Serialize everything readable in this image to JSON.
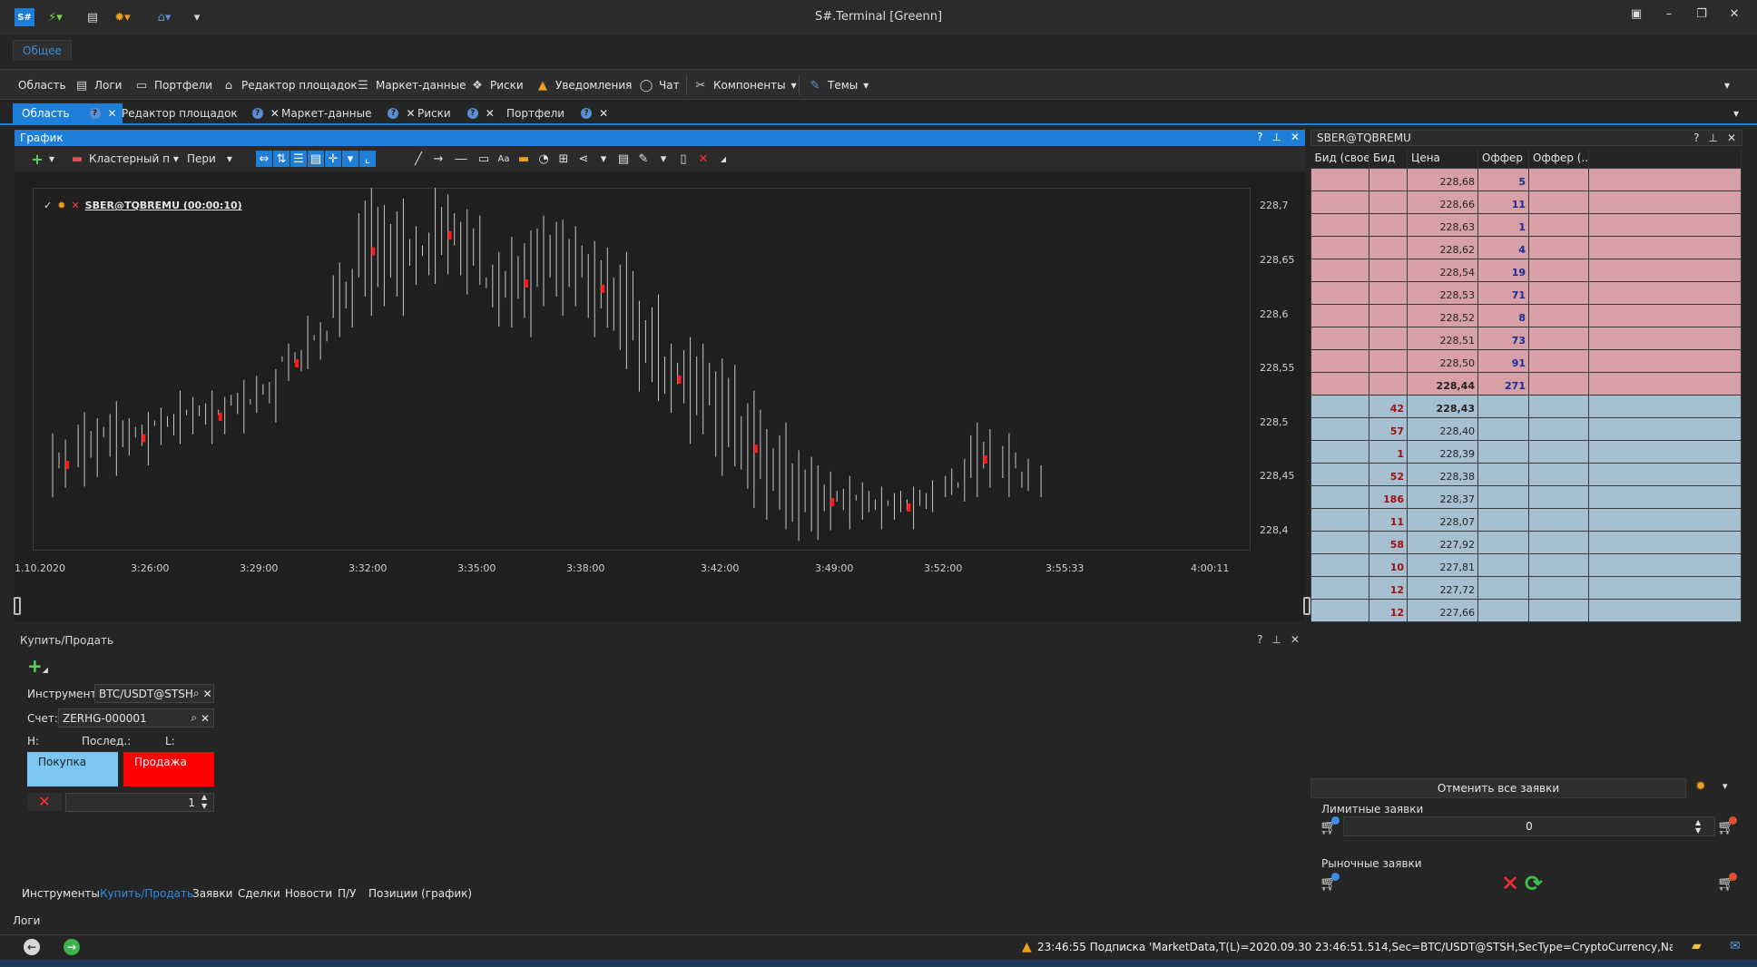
{
  "window": {
    "title": "S#.Terminal [Greenn]",
    "app_badge": "S#"
  },
  "ribbon": {
    "active_tab": "Общее",
    "items": [
      "Область",
      "Логи",
      "Портфели",
      "Редактор площадок",
      "Маркет-данные",
      "Риски",
      "Уведомления",
      "Чат",
      "Компоненты",
      "Темы"
    ]
  },
  "doc_tabs": [
    "Область",
    "Редактор площадок",
    "Маркет-данные",
    "Риски",
    "Портфели"
  ],
  "chart_panel": {
    "title": "График",
    "candle_type": "Кластерный п",
    "period": "Пери",
    "instrument_label": "SBER@TQBREMU (00:00:10)"
  },
  "chart_data": {
    "type": "candlestick",
    "series": [
      {
        "name": "SBER@TQBREMU (00:00:10)"
      }
    ],
    "y_ticks": [
      "228,7",
      "228,65",
      "228,6",
      "228,55",
      "228,5",
      "228,45",
      "228,4"
    ],
    "ylim": [
      228.38,
      228.72
    ],
    "x_ticks": [
      "1.10.2020",
      "3:26:00",
      "3:29:00",
      "3:32:00",
      "3:35:00",
      "3:38:00",
      "3:42:00",
      "3:49:00",
      "3:52:00",
      "3:55:33",
      "4:00:11"
    ],
    "highs": [
      228.49,
      228.51,
      228.52,
      228.51,
      228.52,
      228.53,
      228.53,
      228.54,
      228.55,
      228.58,
      228.6,
      228.65,
      228.72,
      228.71,
      228.69,
      228.72,
      228.7,
      228.66,
      228.68,
      228.7,
      228.69,
      228.67,
      228.66,
      228.62,
      228.58,
      228.58,
      228.56,
      228.53,
      228.5,
      228.48,
      228.46,
      228.45,
      228.44,
      228.44,
      228.44,
      228.45,
      228.5,
      228.49,
      228.46
    ],
    "lows": [
      228.43,
      228.44,
      228.45,
      228.46,
      228.47,
      228.48,
      228.48,
      228.49,
      228.5,
      228.53,
      228.55,
      228.58,
      228.6,
      228.6,
      228.62,
      228.63,
      228.62,
      228.59,
      228.58,
      228.6,
      228.6,
      228.58,
      228.55,
      228.52,
      228.5,
      228.48,
      228.45,
      228.42,
      228.4,
      228.38,
      228.39,
      228.4,
      228.4,
      228.4,
      228.41,
      228.43,
      228.43,
      228.43,
      228.43
    ]
  },
  "buy_sell": {
    "title": "Купить/Продать",
    "instrument_label": "Инструмент:",
    "instrument_value": "BTC/USDT@STSH",
    "account_label": "Счет:",
    "account_value": "ZERHG-000001",
    "h_label": "H:",
    "last_label": "Послед.:",
    "l_label": "L:",
    "buy": "Покупка",
    "sell": "Продажа",
    "quantity": "1"
  },
  "bottom_tabs": [
    "Инструменты",
    "Купить/Продать",
    "Заявки",
    "Сделки",
    "Новости",
    "П/У",
    "Позиции (график)"
  ],
  "bottom_active": "Купить/Продать",
  "logs_label": "Логи",
  "status": {
    "time": "23:46:55",
    "text": "Подписка 'MarketData,T(L)=2020.09.30 23:46:51.514,Sec=BTC/USDT@STSH,SecType=CryptoCurrency,Name=BTC/USDT,Pri"
  },
  "orderbook": {
    "title": "SBER@TQBREMU",
    "columns": [
      "Бид (свое)",
      "Бид",
      "Цена",
      "Оффер",
      "Оффер (..."
    ],
    "asks": [
      {
        "price": "228,68",
        "vol": "5"
      },
      {
        "price": "228,66",
        "vol": "11"
      },
      {
        "price": "228,63",
        "vol": "1"
      },
      {
        "price": "228,62",
        "vol": "4"
      },
      {
        "price": "228,54",
        "vol": "19"
      },
      {
        "price": "228,53",
        "vol": "71"
      },
      {
        "price": "228,52",
        "vol": "8"
      },
      {
        "price": "228,51",
        "vol": "73"
      },
      {
        "price": "228,50",
        "vol": "91"
      },
      {
        "price": "228,44",
        "vol": "271"
      }
    ],
    "bids": [
      {
        "price": "228,43",
        "vol": "42"
      },
      {
        "price": "228,40",
        "vol": "57"
      },
      {
        "price": "228,39",
        "vol": "1"
      },
      {
        "price": "228,38",
        "vol": "52"
      },
      {
        "price": "228,37",
        "vol": "186"
      },
      {
        "price": "228,07",
        "vol": "11"
      },
      {
        "price": "227,92",
        "vol": "58"
      },
      {
        "price": "227,81",
        "vol": "10"
      },
      {
        "price": "227,72",
        "vol": "12"
      },
      {
        "price": "227,66",
        "vol": "12"
      }
    ],
    "cancel_all": "Отменить все заявки",
    "limit_orders_label": "Лимитные заявки",
    "limit_value": "0",
    "market_orders_label": "Рыночные заявки"
  },
  "colors": {
    "accent": "#1e7fd8",
    "ask_bg": "#d6a0a6",
    "bid_bg": "#a7c0d1",
    "sell": "#ff0000",
    "buy": "#7cc6f3",
    "candle": "#c8c8c8",
    "volume_highlight": "#ff1a1a"
  }
}
